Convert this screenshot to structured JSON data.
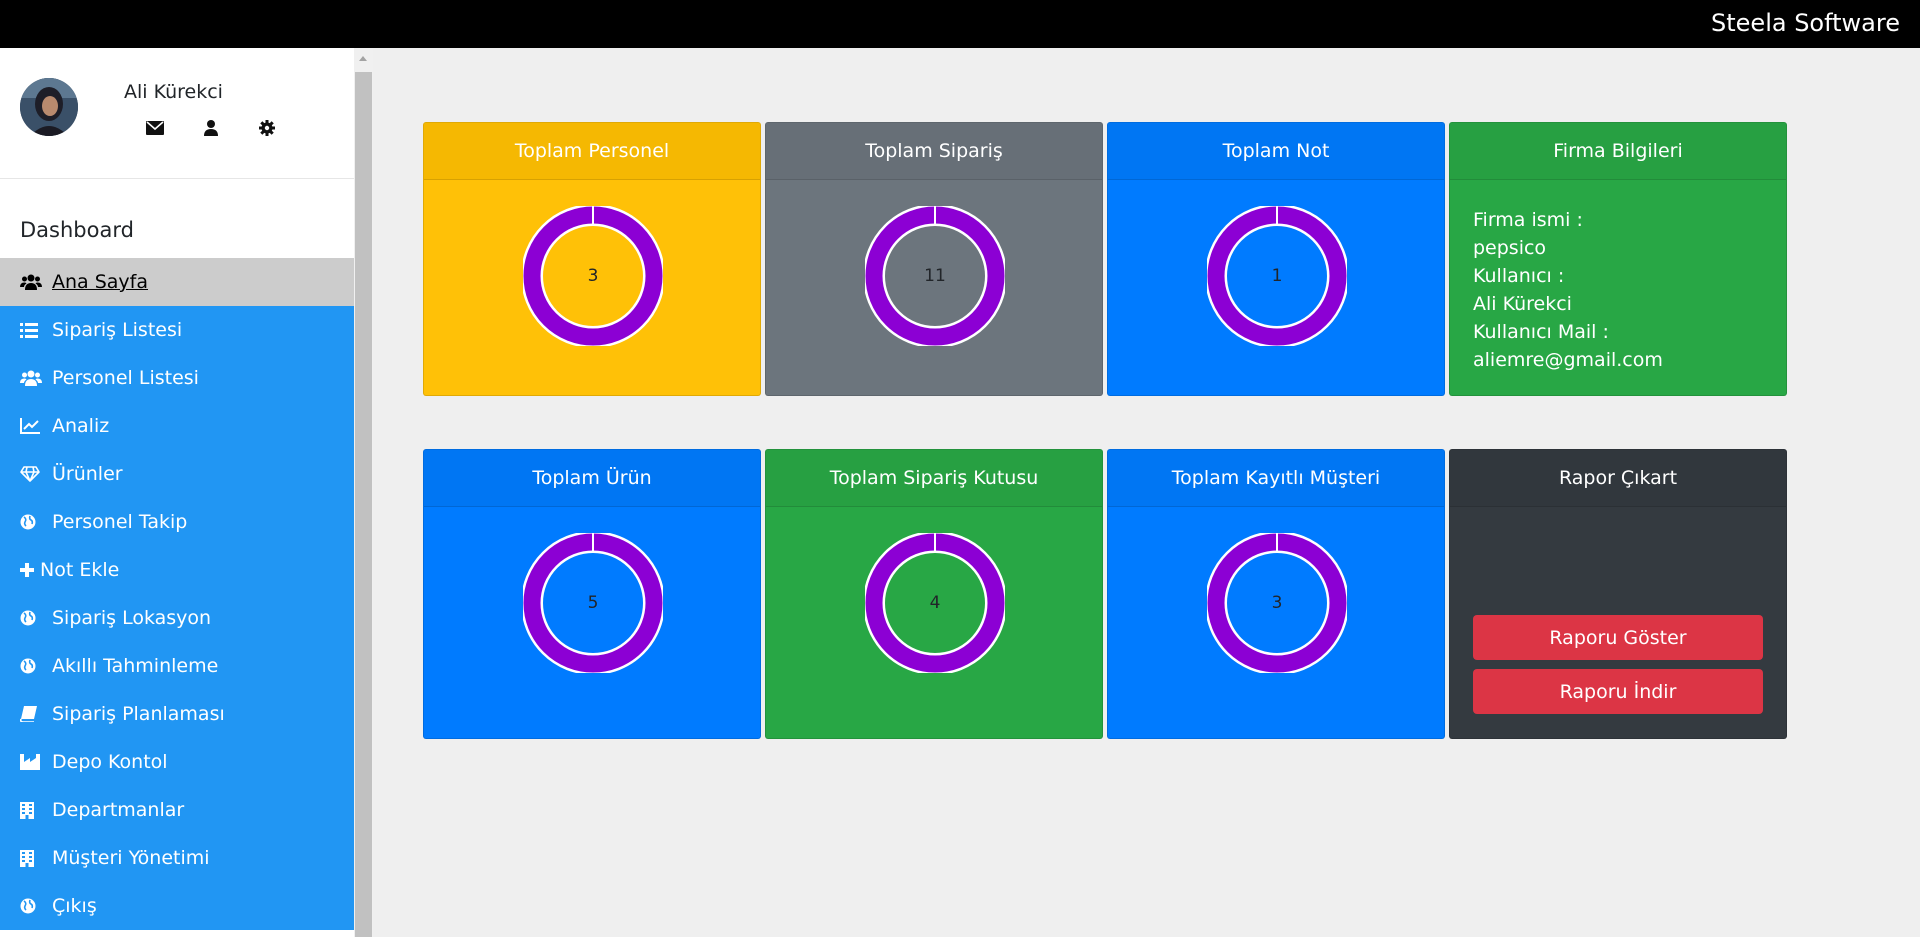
{
  "brand": "Steela Software",
  "profile": {
    "name": "Ali Kürekci",
    "icons": [
      "envelope-icon",
      "user-icon",
      "gear-icon"
    ]
  },
  "sidebar": {
    "title": "Dashboard",
    "items": [
      {
        "label": "Ana Sayfa",
        "icon": "users-icon",
        "active": true
      },
      {
        "label": "Sipariş Listesi",
        "icon": "list-icon"
      },
      {
        "label": "Personel Listesi",
        "icon": "users-icon"
      },
      {
        "label": "Analiz",
        "icon": "line-chart-icon"
      },
      {
        "label": "Ürünler",
        "icon": "diamond-icon"
      },
      {
        "label": "Personel Takip",
        "icon": "globe-icon"
      },
      {
        "label": "Not Ekle",
        "icon": "plus-icon"
      },
      {
        "label": "Sipariş Lokasyon",
        "icon": "globe-icon"
      },
      {
        "label": "Akıllı Tahminleme",
        "icon": "globe-icon"
      },
      {
        "label": "Sipariş Planlaması",
        "icon": "book-icon"
      },
      {
        "label": "Depo Kontol",
        "icon": "industry-icon"
      },
      {
        "label": "Departmanlar",
        "icon": "building-icon"
      },
      {
        "label": "Müşteri Yönetimi",
        "icon": "building-icon"
      },
      {
        "label": "Çıkış",
        "icon": "globe-icon"
      }
    ]
  },
  "cards": {
    "personel": {
      "title": "Toplam Personel",
      "value": "3"
    },
    "siparis": {
      "title": "Toplam Sipariş",
      "value": "11"
    },
    "not": {
      "title": "Toplam Not",
      "value": "1"
    },
    "firma": {
      "title": "Firma Bilgileri",
      "lines": [
        "Firma ismi :",
        "pepsico",
        "Kullanıcı :",
        "Ali Kürekci",
        "Kullanıcı Mail :",
        "aliemre@gmail.com"
      ]
    },
    "urun": {
      "title": "Toplam Ürün",
      "value": "5"
    },
    "kutu": {
      "title": "Toplam Sipariş Kutusu",
      "value": "4"
    },
    "musteri": {
      "title": "Toplam Kayıtlı Müşteri",
      "value": "3"
    },
    "rapor": {
      "title": "Rapor Çıkart",
      "show_label": "Raporu Göster",
      "download_label": "Raporu İndir"
    }
  },
  "colors": {
    "sidebar_blue": "#2196f3",
    "warning": "#ffc107",
    "secondary": "#6c757d",
    "primary": "#007bff",
    "success": "#28a745",
    "dark": "#343a40",
    "danger": "#dc3545",
    "donut_ring": "#8c00d4"
  }
}
